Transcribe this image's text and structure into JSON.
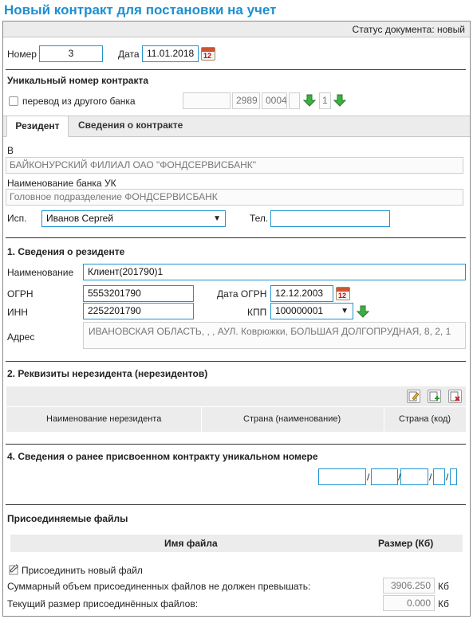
{
  "page_title": "Новый контракт для постановки на учет",
  "status": "Статус документа: новый",
  "number": {
    "label": "Номер",
    "value": "3"
  },
  "date": {
    "label": "Дата",
    "value": "11.01.2018",
    "calendar_day": "12"
  },
  "unique_number": {
    "heading": "Уникальный номер контракта",
    "transfer_label": "перевод из другого банка",
    "part1": "",
    "part2": "2989",
    "part3": "0004",
    "part4": "",
    "part5": "1"
  },
  "tabs": [
    {
      "label": "Резидент",
      "active": true
    },
    {
      "label": "Сведения о контракте",
      "active": false
    }
  ],
  "bank": {
    "to_label": "В",
    "to_value": "БАЙКОНУРСКИЙ ФИЛИАЛ ОАО \"ФОНДСЕРВИСБАНК\"",
    "uk_label": "Наименование банка УК",
    "uk_value": "Головное подразделение ФОНДСЕРВИСБАНК",
    "executor_label": "Исп.",
    "executor_value": "Иванов Сергей",
    "phone_label": "Тел.",
    "phone_value": ""
  },
  "resident": {
    "heading": "1. Сведения о резиденте",
    "name_label": "Наименование",
    "name_value": "Клиент(201790)1",
    "ogrn_label": "ОГРН",
    "ogrn_value": "5553201790",
    "ogrn_date_label": "Дата ОГРН",
    "ogrn_date_value": "12.12.2003",
    "inn_label": "ИНН",
    "inn_value": "2252201790",
    "kpp_label": "КПП",
    "kpp_value": "100000001",
    "address_label": "Адрес",
    "address_value": "ИВАНОВСКАЯ ОБЛАСТЬ, , , АУЛ. Коврюжки, БОЛЬШАЯ ДОЛГОПРУДНАЯ, 8, 2, 1"
  },
  "nonresidents": {
    "heading": "2. Реквизиты нерезидента (нерезидентов)",
    "columns": [
      "Наименование нерезидента",
      "Страна (наименование)",
      "Страна (код)"
    ]
  },
  "previous": {
    "heading": "4. Сведения о ранее присвоенном контракту уникальном номере",
    "sep": "/"
  },
  "files": {
    "heading": "Присоединяемые файлы",
    "columns": [
      "Имя файла",
      "Размер (Кб)"
    ],
    "attach_label": "Присоединить новый файл",
    "max_label": "Суммарный объем присоединенных файлов не должен превышать:",
    "max_value": "3906.250",
    "current_label": "Текущий размер присоединённых файлов:",
    "current_value": "0.000",
    "unit": "Кб"
  },
  "colors": {
    "accent": "#1d8fcf",
    "field_border": "#1d95d0",
    "arrow_green": "#3cb043"
  }
}
